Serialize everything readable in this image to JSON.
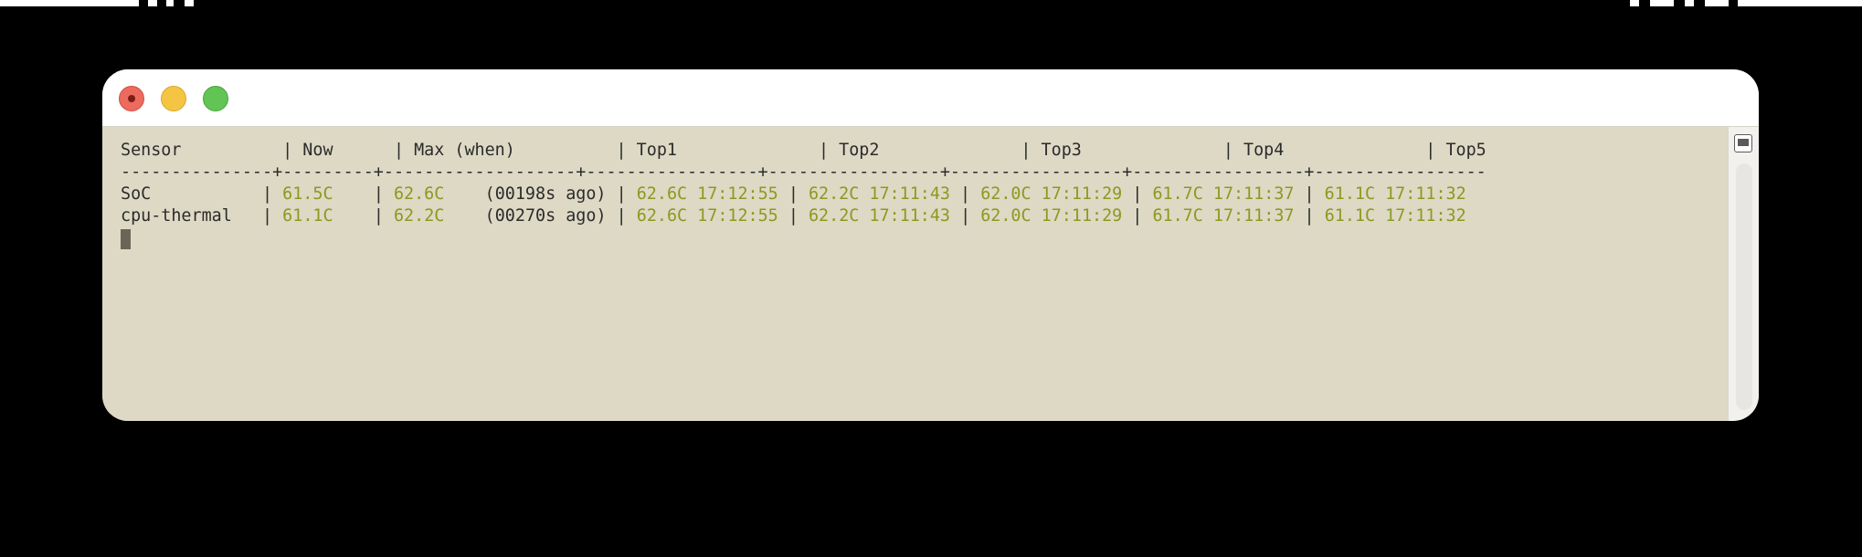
{
  "window": {
    "controls": [
      "close",
      "minimize",
      "maximize"
    ]
  },
  "terminal": {
    "header": "Sensor          | Now      | Max (when)          | Top1              | Top2              | Top3              | Top4              | Top5",
    "separator": "---------------+---------+-------------------+-----------------+-----------------+-----------------+-----------------+-----------------",
    "rows": [
      {
        "sensor": "SoC",
        "now": "61.5C",
        "max": "62.6C",
        "when": "(00198s ago)",
        "top": [
          "62.6C 17:12:55",
          "62.2C 17:11:43",
          "62.0C 17:11:29",
          "61.7C 17:11:37",
          "61.1C 17:11:32"
        ]
      },
      {
        "sensor": "cpu-thermal",
        "now": "61.1C",
        "max": "62.2C",
        "when": "(00270s ago)",
        "top": [
          "62.6C 17:12:55",
          "62.2C 17:11:43",
          "62.0C 17:11:29",
          "61.7C 17:11:37",
          "61.1C 17:11:32"
        ]
      }
    ]
  },
  "colors": {
    "terminal_bg": "#ddd9c5",
    "value_green": "#8a9a1e",
    "text": "#2b2b2b"
  },
  "icons": {
    "scrollbar_button": "list-icon"
  }
}
